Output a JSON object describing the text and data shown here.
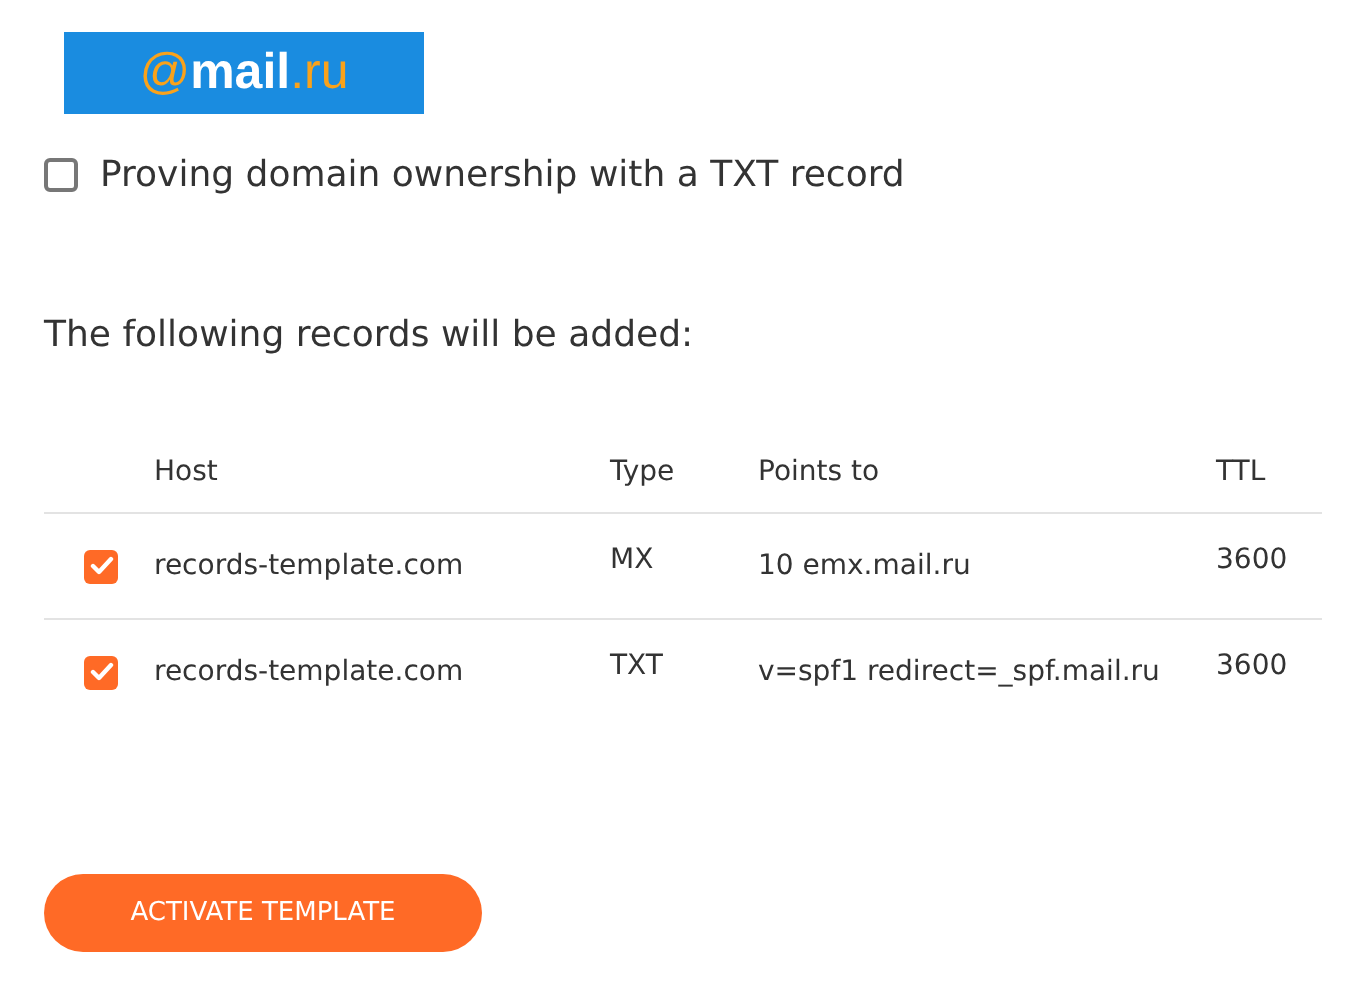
{
  "logo": {
    "at": "@",
    "name": "mail",
    "domain": ".ru"
  },
  "txt_option": {
    "label": "Proving domain ownership with a TXT record",
    "checked": false
  },
  "heading": "The following records will be added:",
  "table": {
    "columns": [
      "Host",
      "Type",
      "Points to",
      "TTL"
    ],
    "rows": [
      {
        "checked": true,
        "host": "records-template.com",
        "type": "MX",
        "points_to": "10 emx.mail.ru",
        "ttl": "3600"
      },
      {
        "checked": true,
        "host": "records-template.com",
        "type": "TXT",
        "points_to": "v=spf1 redirect=_spf.mail.ru",
        "ttl": "3600"
      }
    ]
  },
  "button": "ACTIVATE TEMPLATE"
}
